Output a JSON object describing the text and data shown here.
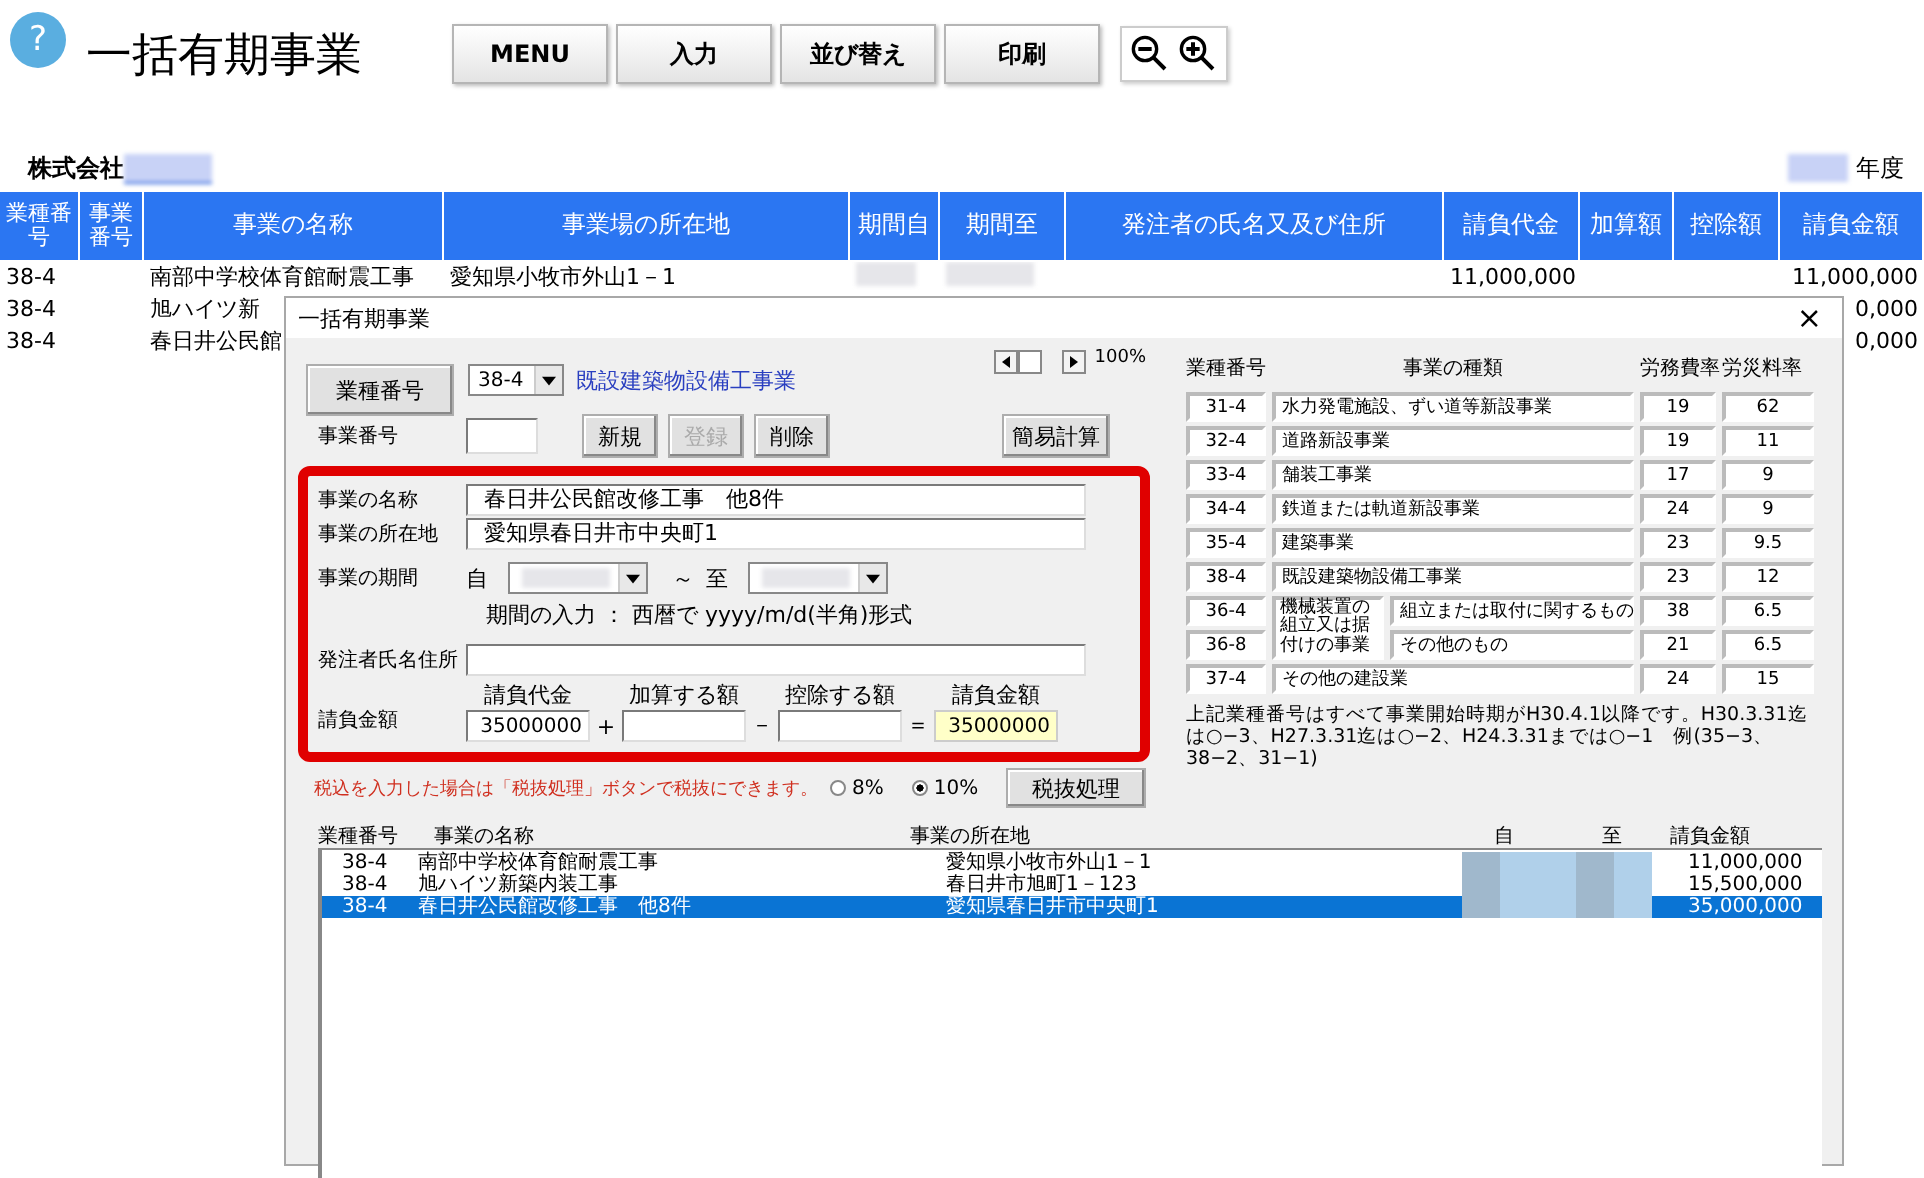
{
  "app": {
    "help": "?",
    "title": "一括有期事業"
  },
  "toolbar": {
    "buttons": [
      "MENU",
      "入力",
      "並び替え",
      "印刷"
    ]
  },
  "company": {
    "label": "株式会社",
    "year_label": "年度"
  },
  "table": {
    "columns": [
      "業種番号",
      "事業番号",
      "事業の名称",
      "事業場の所在地",
      "期間自",
      "期間至",
      "発注者の氏名又及び住所",
      "請負代金",
      "加算額",
      "控除額",
      "請負金額"
    ],
    "rows": [
      {
        "code": "38-4",
        "name": "南部中学校体育館耐震工事",
        "location": "愛知県小牧市外山1－1",
        "price": "11,000,000",
        "total": "11,000,000"
      },
      {
        "code": "38-4",
        "name": "旭ハイツ新",
        "total": "0,000"
      },
      {
        "code": "38-4",
        "name": "春日井公民館",
        "total": "0,000"
      }
    ]
  },
  "dialog": {
    "title": "一括有期事業",
    "close": "×",
    "category_button": "業種番号",
    "category_code": "38-4",
    "category_name": "既設建築物設備工事業",
    "zoom": "100%",
    "number_label": "事業番号",
    "actions": [
      {
        "label": "新規",
        "disabled": false
      },
      {
        "label": "登録",
        "disabled": true
      },
      {
        "label": "削除",
        "disabled": false
      }
    ],
    "calc_button": "簡易計算",
    "name_label": "事業の名称",
    "name_value": "春日井公民館改修工事　他8件",
    "location_label": "事業の所在地",
    "location_value": "愛知県春日井市中央町1",
    "period_label": "事業の期間",
    "from": "自",
    "tilde": "～",
    "to": "至",
    "period_hint": "期間の入力 ： 西暦で yyyy/m/d(半角)形式",
    "orderer_label": "発注者氏名住所",
    "amount_label": "請負金額",
    "amounts": [
      {
        "caption": "請負代金",
        "value": "35000000",
        "kind": "input"
      },
      {
        "op": "+",
        "caption": "加算する額",
        "kind": "input"
      },
      {
        "op": "－",
        "caption": "控除する額",
        "kind": "input"
      },
      {
        "op": "＝",
        "caption": "請負金額",
        "value": "35000000",
        "kind": "result"
      }
    ],
    "tax_note": "税込を入力した場合は「税抜処理」ボタンで税抜にできます。",
    "tax_rates": [
      {
        "label": "8%",
        "selected": false
      },
      {
        "label": "10%",
        "selected": true
      }
    ],
    "tax_button": "税抜処理",
    "rate_table": {
      "columns": [
        "業種番号",
        "事業の種類",
        "労務費率",
        "労災料率"
      ],
      "rows": [
        {
          "kind": "plain",
          "code": "31-4",
          "name": "水力発電施設、ずい道等新設事業",
          "labor": "19",
          "accident": "62"
        },
        {
          "kind": "plain",
          "code": "32-4",
          "name": "道路新設事業",
          "labor": "19",
          "accident": "11"
        },
        {
          "kind": "plain",
          "code": "33-4",
          "name": "舗装工事業",
          "labor": "17",
          "accident": "9"
        },
        {
          "kind": "plain",
          "code": "34-4",
          "name": "鉄道または軌道新設事業",
          "labor": "24",
          "accident": "9"
        },
        {
          "kind": "plain",
          "code": "35-4",
          "name": "建築事業",
          "labor": "23",
          "accident": "9.5"
        },
        {
          "kind": "plain",
          "code": "38-4",
          "name": "既設建築物設備工事業",
          "labor": "23",
          "accident": "12"
        },
        {
          "kind": "group",
          "name": "機械装置の組立又は据付けの事業",
          "children": [
            {
              "code": "36-4",
              "name": "組立または取付に関するもの",
              "labor": "38",
              "accident": "6.5"
            },
            {
              "code": "36-8",
              "name": "その他のもの",
              "labor": "21",
              "accident": "6.5"
            }
          ]
        },
        {
          "kind": "plain",
          "code": "37-4",
          "name": "その他の建設業",
          "labor": "24",
          "accident": "15"
        }
      ]
    },
    "rate_note": "上記業種番号はすべて事業開始時期がH30.4.1以降です。H30.3.31迄は○−3、H27.3.31迄は○−2、H24.3.31までは○−1　例(35−3、38−2、31−1)",
    "list": {
      "columns": [
        "業種番号",
        "事業の名称",
        "事業の所在地",
        "自",
        "至",
        "請負金額"
      ],
      "rows": [
        {
          "code": "38-4",
          "name": "南部中学校体育館耐震工事",
          "location": "愛知県小牧市外山1－1",
          "amount": "11,000,000",
          "selected": false
        },
        {
          "code": "38-4",
          "name": "旭ハイツ新築内装工事",
          "location": "春日井市旭町1－123",
          "amount": "15,500,000",
          "selected": false
        },
        {
          "code": "38-4",
          "name": "春日井公民館改修工事　他8件",
          "location": "愛知県春日井市中央町1",
          "amount": "35,000,000",
          "selected": true
        }
      ]
    }
  }
}
